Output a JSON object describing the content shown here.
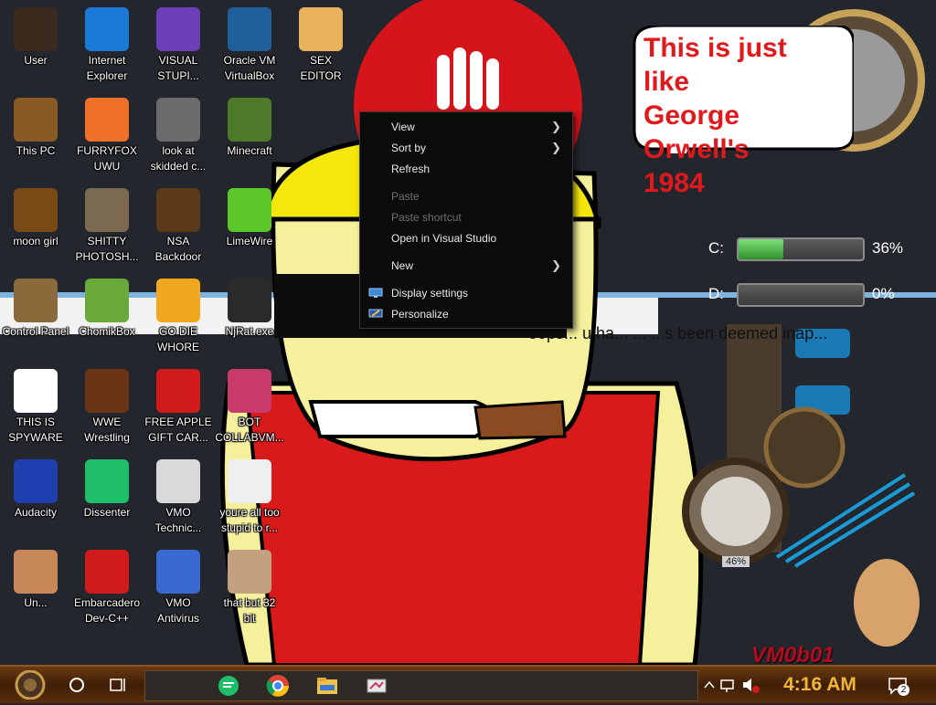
{
  "desktop": {
    "icons": [
      {
        "label": "User",
        "icon": "user-folder-icon",
        "color": "#3b2a1d"
      },
      {
        "label": "Internet\nExplorer",
        "icon": "edge-browser-icon",
        "color": "#1b7ad8"
      },
      {
        "label": "VISUAL\nSTUPI...",
        "icon": "visual-studio-icon",
        "color": "#6b3fb8"
      },
      {
        "label": "Oracle VM\nVirtualBox",
        "icon": "virtualbox-icon",
        "color": "#1f5f9c"
      },
      {
        "label": "SEX\nEDITOR",
        "icon": "hxd-editor-icon",
        "color": "#e8b35a"
      },
      {
        "label": "This PC",
        "icon": "computer-icon",
        "color": "#8a5a24"
      },
      {
        "label": "FURRYFOX\nUWU",
        "icon": "firefox-icon",
        "color": "#f0702a"
      },
      {
        "label": "look at\nskidded c...",
        "icon": "folder-stack-icon",
        "color": "#6b6b6b"
      },
      {
        "label": "Minecraft",
        "icon": "minecraft-icon",
        "color": "#4d7a2a"
      },
      {
        "label": "moon girl",
        "icon": "file-icon",
        "color": "#7a4a16"
      },
      {
        "label": "SHITTY\nPHOTOSH...",
        "icon": "gimp-icon",
        "color": "#7b6a50"
      },
      {
        "label": "NSA\nBackdoor",
        "icon": "shortcut-folder-icon",
        "color": "#5b3a18"
      },
      {
        "label": "LimeWire",
        "icon": "limewire-icon",
        "color": "#5cc82a"
      },
      {
        "label": "Control Panel",
        "icon": "control-panel-icon",
        "color": "#8a6a3a"
      },
      {
        "label": "ChomikBox",
        "icon": "chomikbox-icon",
        "color": "#6aa83a"
      },
      {
        "label": "GO DIE\nWHORE",
        "icon": "de-app-icon",
        "color": "#f2a81e"
      },
      {
        "label": "NjRat.exe",
        "icon": "skull-icon",
        "color": "#2a2a2a"
      },
      {
        "label": "THIS IS\nSPYWARE",
        "icon": "chrome-icon",
        "color": "#ffffff"
      },
      {
        "label": "WWE\nWrestling",
        "icon": "wwe-icon",
        "color": "#6a3415"
      },
      {
        "label": "FREE APPLE\nGIFT CAR...",
        "icon": "apple-icon",
        "color": "#d11a1a"
      },
      {
        "label": "BOT\nCOLLABVM...",
        "icon": "monitor-icon",
        "color": "#c73a6a"
      },
      {
        "label": "Audacity",
        "icon": "audacity-icon",
        "color": "#1d3fb0"
      },
      {
        "label": "Dissenter",
        "icon": "dissenter-icon",
        "color": "#1fbf6a"
      },
      {
        "label": "VMO\nTechnic...",
        "icon": "technician-icon",
        "color": "#d9d9d9"
      },
      {
        "label": "youre all too\nstupid to r...",
        "icon": "portrait-icon",
        "color": "#efefef"
      },
      {
        "label": "Un...",
        "icon": "hank-icon",
        "color": "#c9885a"
      },
      {
        "label": "Embarcadero\nDev-C++",
        "icon": "devcpp-icon",
        "color": "#d11a1a"
      },
      {
        "label": "VMO\nAntivirus",
        "icon": "shield-icon",
        "color": "#3a6ad1"
      },
      {
        "label": "that but 32\nbit",
        "icon": "portrait-icon",
        "color": "#c2a080"
      }
    ]
  },
  "context_menu": {
    "view": "View",
    "sort_by": "Sort by",
    "refresh": "Refresh",
    "paste": "Paste",
    "paste_shortcut": "Paste shortcut",
    "open_vs": "Open in Visual Studio",
    "new": "New",
    "display_settings": "Display settings",
    "personalize": "Personalize"
  },
  "speech_bubble": {
    "text": "This is just like\nGeorge Orwell's\n1984"
  },
  "drives": [
    {
      "label": "C:",
      "percent_text": "36%",
      "fill": 0.36
    },
    {
      "label": "D:",
      "percent_text": "0%",
      "fill": 0.0
    }
  ],
  "banner": {
    "text": "oops... u ha... ... ...s been deemed inap..."
  },
  "gauge": {
    "readout": "46%"
  },
  "watermark": {
    "text": "VM0b01"
  },
  "taskbar": {
    "clock": "4:16 AM",
    "notification_count": "2",
    "apps": [
      "dissenter-icon",
      "chrome-icon",
      "file-explorer-icon",
      "monitor-icon"
    ]
  },
  "colors": {
    "accent_red": "#e0191c",
    "taskbar_brown": "#5a2e0b",
    "clock_gold": "#f2b635"
  }
}
